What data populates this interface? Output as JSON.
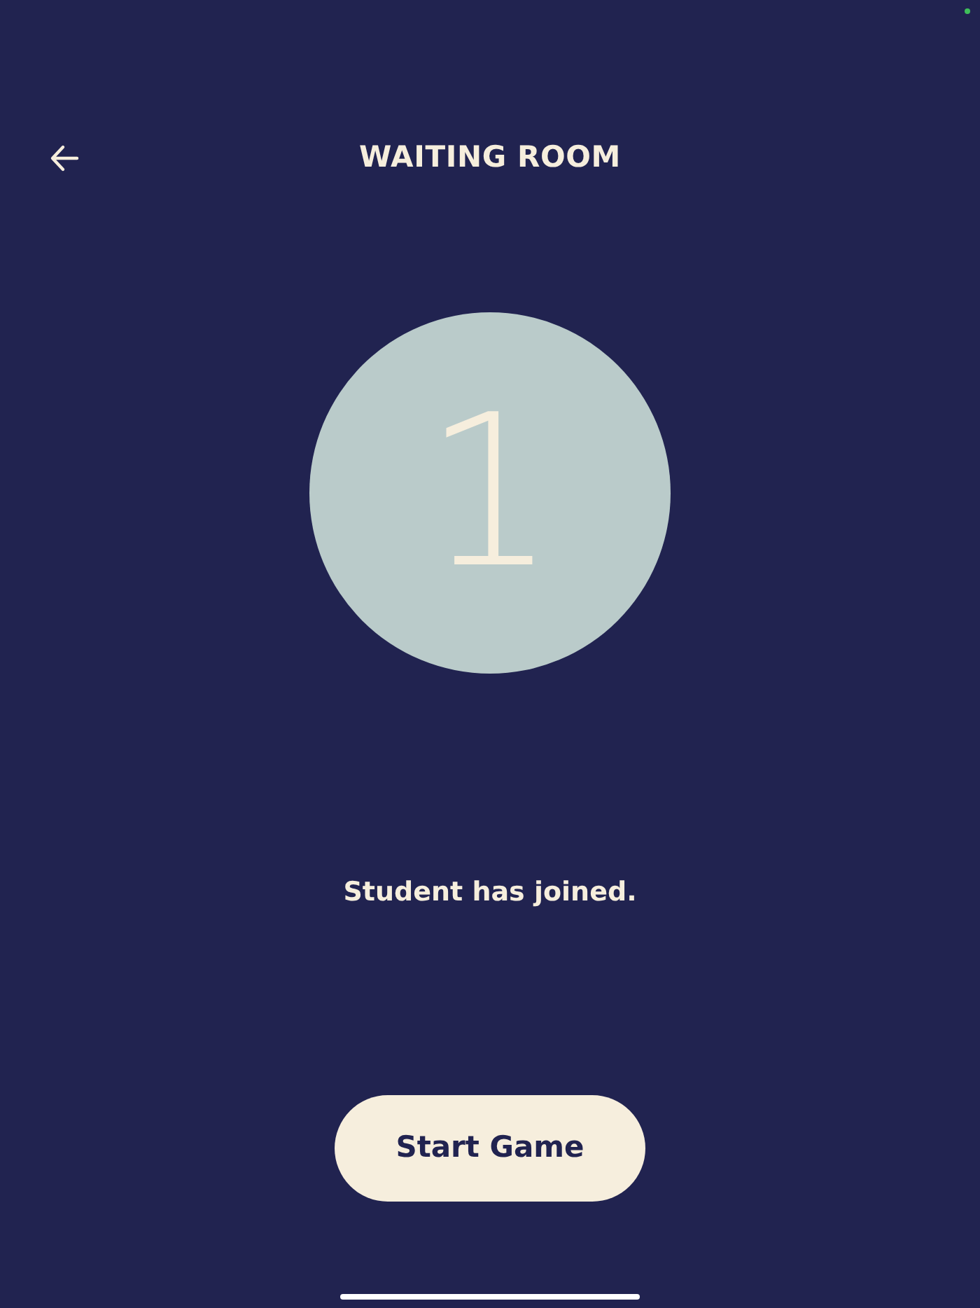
{
  "header": {
    "title": "WAITING ROOM"
  },
  "counter": {
    "value": "1"
  },
  "status_message": "Student has joined.",
  "buttons": [
    {
      "label": "Start Game"
    }
  ]
}
